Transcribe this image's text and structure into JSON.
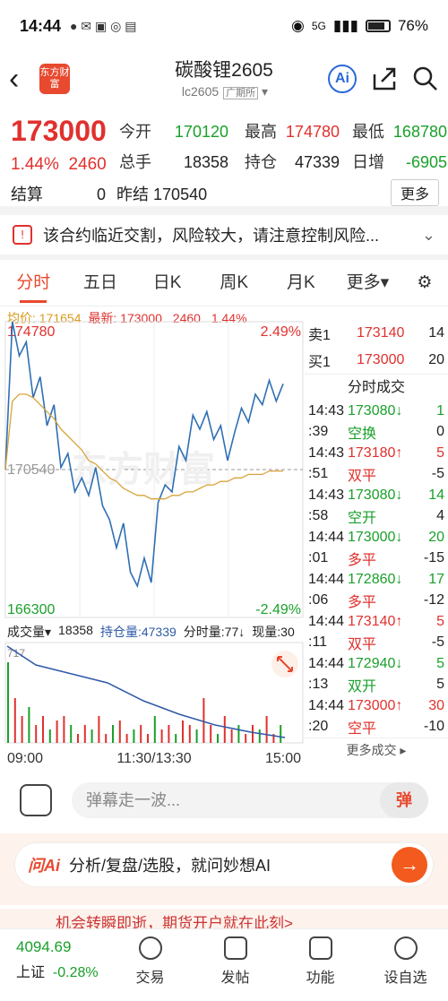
{
  "status": {
    "time": "14:44",
    "network": "5G",
    "battery": "76%"
  },
  "header": {
    "logo": "东方财富",
    "name": "碳酸锂2605",
    "code": "lc2605",
    "exchange": "广期所"
  },
  "quote": {
    "price": "173000",
    "pct": "1.44%",
    "change": "2460",
    "open_label": "今开",
    "open": "170120",
    "high_label": "最高",
    "high": "174780",
    "low_label": "最低",
    "low": "168780",
    "vol_label": "总手",
    "vol": "18358",
    "oi_label": "持仓",
    "oi": "47339",
    "daily_label": "日增",
    "daily": "-6905",
    "settle_label": "结算",
    "settle": "0",
    "prev_label": "昨结",
    "prev": "170540",
    "more": "更多"
  },
  "notice": "该合约临近交割，风险较大，请注意控制风险...",
  "tabs": [
    "分时",
    "五日",
    "日K",
    "周K",
    "月K",
    "更多▾"
  ],
  "avgline": {
    "avg_label": "均价:",
    "avg": "171654",
    "last_label": "最新:",
    "last": "173000",
    "chg": "2460",
    "pct": "1.44%"
  },
  "chart": {
    "top": "174780",
    "top_pct": "2.49%",
    "mid": "170540",
    "bottom": "166300",
    "bottom_pct": "-2.49%",
    "vol_label": "成交量",
    "vol": "18358",
    "oi_label": "持仓量:47339",
    "tick_label": "分时量:77↓",
    "now_label": "现量:30",
    "max_vol": "717",
    "t0": "09:00",
    "t1": "11:30/13:30",
    "t2": "15:00",
    "watermark": "东方财富"
  },
  "chart_data": {
    "type": "line",
    "title": "",
    "xlabel": "",
    "ylabel": "",
    "ylim": [
      166300,
      174780
    ],
    "reference": 170540,
    "series": [
      {
        "name": "价格",
        "values": [
          170540,
          174780,
          173800,
          174200,
          172600,
          173200,
          171800,
          172400,
          170600,
          171000,
          169900,
          170300,
          169800,
          170600,
          169500,
          169100,
          168300,
          169000,
          167600,
          167200,
          168000,
          167300,
          169600,
          170100,
          169900,
          171200,
          170800,
          172100,
          171700,
          172200,
          171400,
          171800,
          170800,
          171600,
          172300,
          171900,
          172700,
          172400,
          173100,
          172500,
          173000
        ]
      },
      {
        "name": "均价",
        "values": [
          170540,
          172500,
          172700,
          172700,
          172600,
          172400,
          172200,
          172000,
          171700,
          171500,
          171300,
          171100,
          170800,
          170700,
          170500,
          170300,
          170200,
          170000,
          169900,
          169800,
          169800,
          169700,
          169700,
          169700,
          169800,
          169800,
          169900,
          169900,
          170000,
          170100,
          170100,
          170200,
          170200,
          170300,
          170300,
          170400,
          170400,
          170400,
          170500,
          170500,
          170500
        ]
      }
    ]
  },
  "orderbook": {
    "sell_label": "卖1",
    "sell_price": "173140",
    "sell_vol": "14",
    "buy_label": "买1",
    "buy_price": "173000",
    "buy_vol": "20",
    "head": "分时成交",
    "trades": [
      [
        "14:43",
        "173080↓",
        "1"
      ],
      [
        ":39",
        "空换",
        "0"
      ],
      [
        "14:43",
        "173180↑",
        "5"
      ],
      [
        ":51",
        "双平",
        "-5"
      ],
      [
        "14:43",
        "173080↓",
        "14"
      ],
      [
        ":58",
        "空开",
        "4"
      ],
      [
        "14:44",
        "173000↓",
        "20"
      ],
      [
        ":01",
        "多平",
        "-15"
      ],
      [
        "14:44",
        "172860↓",
        "17"
      ],
      [
        ":06",
        "多平",
        "-12"
      ],
      [
        "14:44",
        "173140↑",
        "5"
      ],
      [
        ":11",
        "双平",
        "-5"
      ],
      [
        "14:44",
        "172940↓",
        "5"
      ],
      [
        ":13",
        "双开",
        "5"
      ],
      [
        "14:44",
        "173000↑",
        "30"
      ],
      [
        ":20",
        "空平",
        "-10"
      ]
    ],
    "more": "更多成交 ▸"
  },
  "danmu": {
    "placeholder": "弹幕走一波...",
    "btn": "弹"
  },
  "ai": {
    "logo": "问Ai",
    "text": "分析/复盘/选股，就问妙想AI"
  },
  "promo": "机会转瞬即逝，期货开户就在此刻>",
  "nav": {
    "index_value": "4094.69",
    "index_name": "上证",
    "index_pct": "-0.28%",
    "items": [
      "交易",
      "发帖",
      "功能",
      "设自选"
    ]
  }
}
